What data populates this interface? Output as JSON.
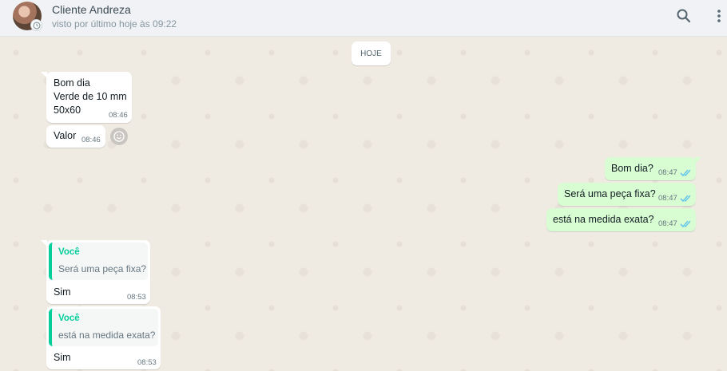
{
  "header": {
    "contact_name": "Cliente Andreza",
    "last_seen": "visto por último hoje às 09:22",
    "icons": [
      "search-icon",
      "menu-icon"
    ]
  },
  "chat": {
    "date_chip": "HOJE",
    "messages": [
      {
        "dir": "in",
        "text": "Bom dia\nVerde de 10 mm\n50x60",
        "time": "08:46"
      },
      {
        "dir": "in",
        "text": "Valor",
        "time": "08:46"
      },
      {
        "dir": "out",
        "text": "Bom dia?",
        "time": "08:47",
        "status": "read"
      },
      {
        "dir": "out",
        "text": "Será uma peça fixa?",
        "time": "08:47",
        "status": "read"
      },
      {
        "dir": "out",
        "text": "está na medida exata?",
        "time": "08:47",
        "status": "read"
      },
      {
        "dir": "in",
        "quote_author": "Você",
        "quote_text": "Será uma peça fixa?",
        "text": "Sim",
        "time": "08:53"
      },
      {
        "dir": "in",
        "quote_author": "Você",
        "quote_text": "está na medida exata?",
        "text": "Sim",
        "time": "08:53"
      }
    ]
  },
  "colors": {
    "chat_background": "#efeae2",
    "incoming_bubble": "#ffffff",
    "outgoing_bubble": "#d9fdd3",
    "read_ticks": "#53bdeb",
    "quote_accent": "#06cf9c"
  }
}
